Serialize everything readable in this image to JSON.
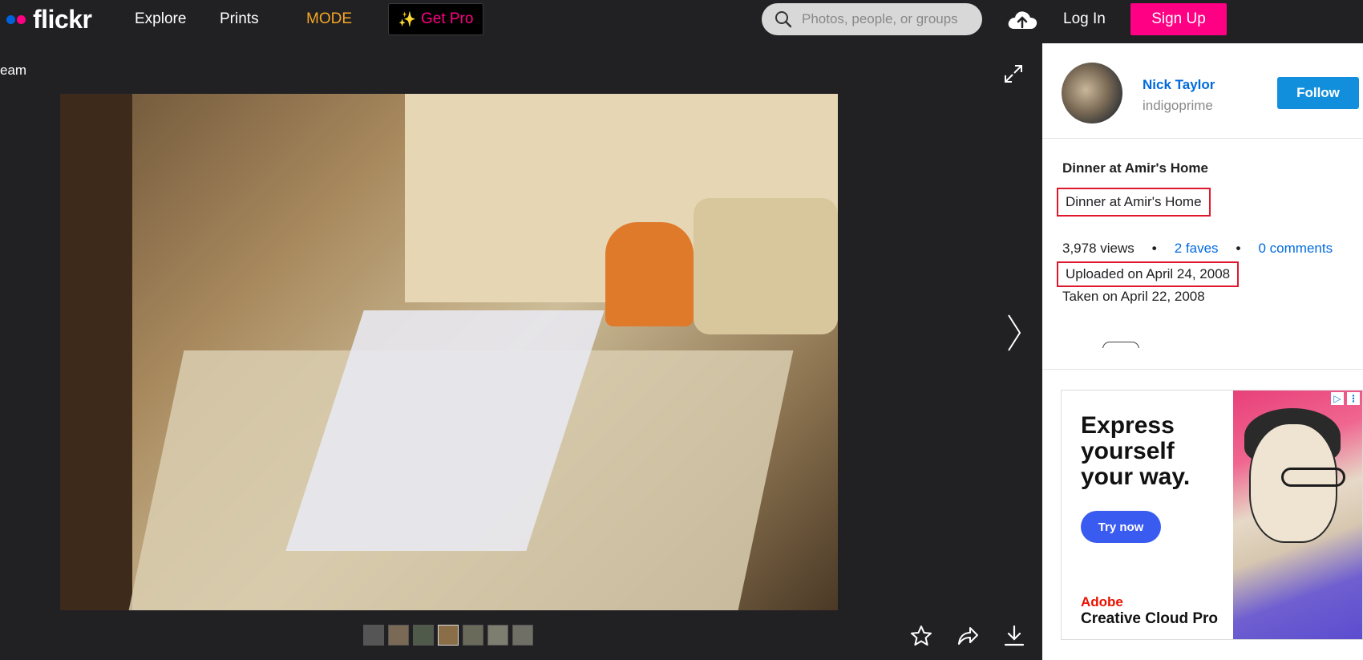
{
  "nav": {
    "logo": "flickr",
    "links": [
      "Explore",
      "Prints",
      "MODE"
    ],
    "get_pro": "Get Pro",
    "search_placeholder": "Photos, people, or groups",
    "login": "Log In",
    "signup": "Sign Up"
  },
  "photo_area": {
    "breadcrumb": "eam",
    "thumbnail_count": 7
  },
  "sidebar": {
    "owner": {
      "name": "Nick Taylor",
      "username": "indigoprime",
      "follow_label": "Follow"
    },
    "photo": {
      "title": "Dinner at Amir's Home",
      "description": "Dinner at Amir's Home",
      "views": "3,978 views",
      "faves": "2 faves",
      "comments": "0 comments",
      "uploaded": "Uploaded on April 24, 2008",
      "taken": "Taken on April 22, 2008"
    },
    "ad": {
      "headline": "Express yourself your way.",
      "cta": "Try now",
      "brand": "Adobe",
      "product": "Creative Cloud Pro"
    }
  },
  "colors": {
    "brand_blue": "#0063dc",
    "brand_pink": "#ff0084",
    "mode_orange": "#f5a623",
    "follow_blue": "#128fdc",
    "highlight_red": "#e0182d"
  }
}
